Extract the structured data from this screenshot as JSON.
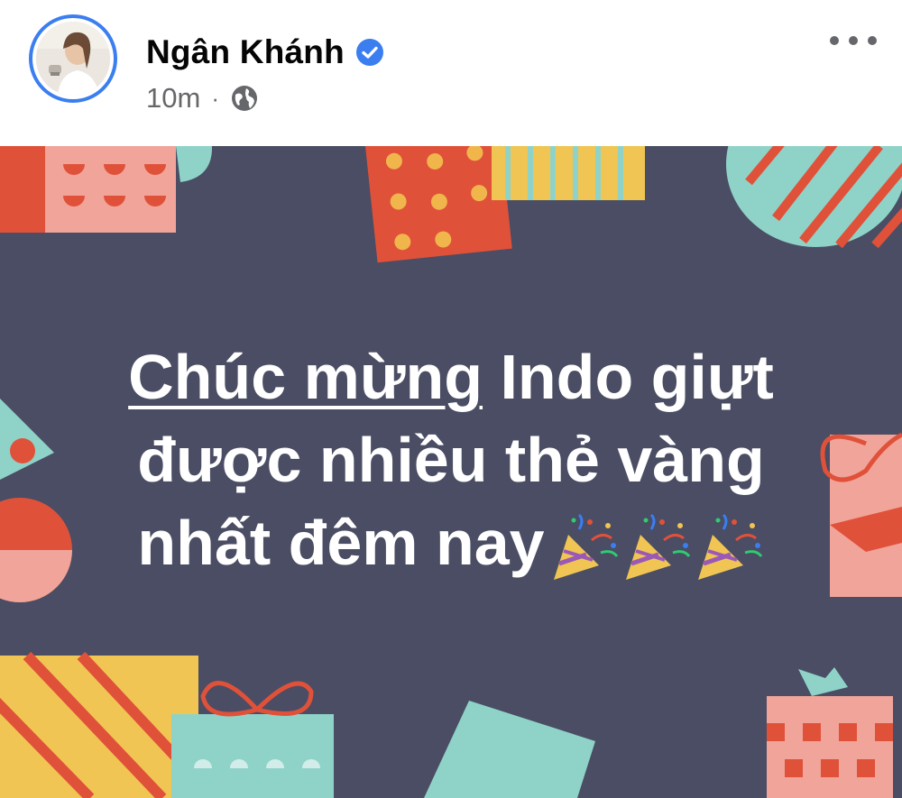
{
  "post": {
    "author": {
      "name": "Ngân Khánh",
      "verified": true,
      "avatar_icon": "profile-photo"
    },
    "timestamp": "10m",
    "separator": "·",
    "privacy_icon": "globe-icon",
    "more_icon": "more-options-icon"
  },
  "status": {
    "background_color": "#4a4d63",
    "line1_underlined": "Chúc mừng",
    "line1_rest": " Indo giựt",
    "line2": "được nhiều thẻ vàng",
    "line3": "nhất đêm nay",
    "emoji": [
      "party-popper-icon",
      "party-popper-icon",
      "party-popper-icon"
    ]
  },
  "colors": {
    "accent": "#3a7ef0",
    "name_text": "#050505",
    "meta_text": "#65676b",
    "card_bg": "#4a4d63",
    "card_text": "#ffffff"
  }
}
